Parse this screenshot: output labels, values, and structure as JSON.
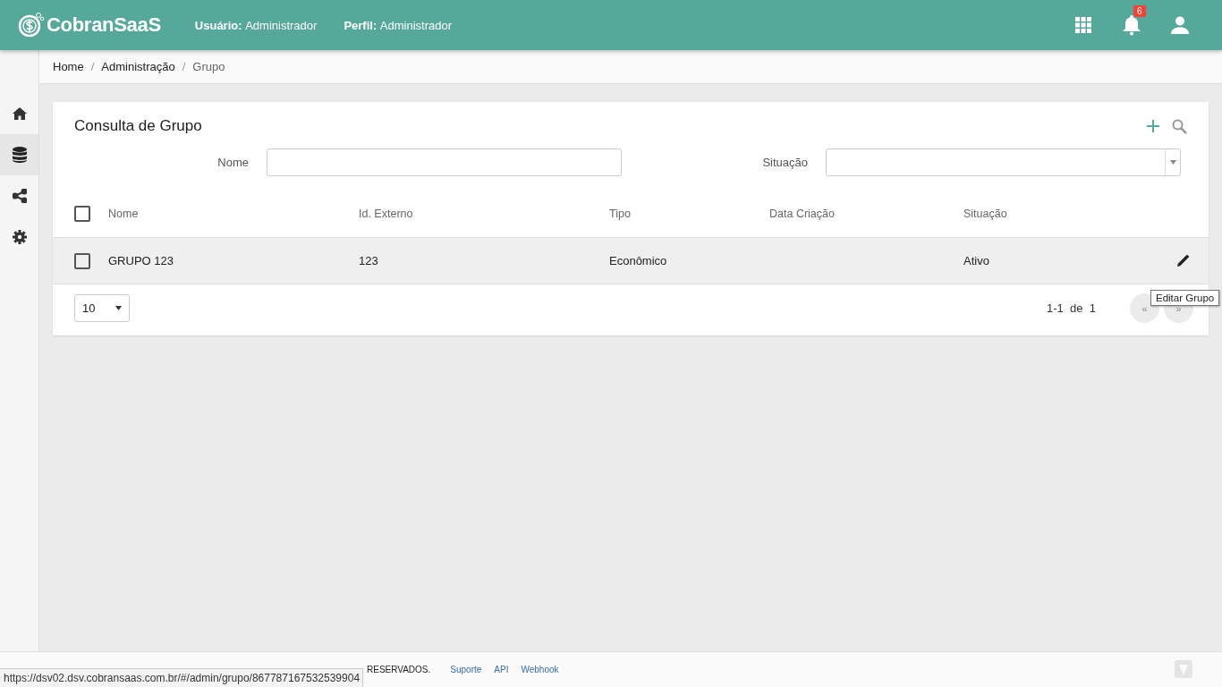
{
  "header": {
    "logo": "CobranSaaS",
    "user_label": "Usuário:",
    "user": "Administrador",
    "profile_label": "Perfil:",
    "profile": "Administrador",
    "notification_count": "6"
  },
  "sidebar": {
    "items": [
      {
        "kind": "home",
        "selected": false
      },
      {
        "kind": "database",
        "selected": true
      },
      {
        "kind": "share",
        "selected": false
      },
      {
        "kind": "settings",
        "selected": false
      }
    ]
  },
  "breadcrumb": {
    "items": [
      "Home",
      "Administração",
      "Grupo"
    ],
    "separators": [
      "/",
      "/"
    ]
  },
  "card": {
    "title": "Consulta de Grupo",
    "filters": [
      {
        "label": "Nome",
        "kind": "text"
      },
      {
        "label": "Situação",
        "kind": "select"
      }
    ],
    "table": {
      "select_all_checked": false,
      "columns": [
        "Nome",
        "Id. Externo",
        "Tipo",
        "Data Criação",
        "Situação"
      ],
      "rows": [
        {
          "checked": false,
          "nome": "GRUPO 123",
          "id_externo": "123",
          "tipo": "Econômico",
          "situacao": "Ativo"
        }
      ]
    },
    "page_size": "10",
    "range": "1-1",
    "of_label": "de",
    "total": "1",
    "prev": "«",
    "next": "»"
  },
  "tooltip": "Editar Grupo",
  "footer": {
    "text": "RESERVADOS.",
    "links": [
      "Suporte",
      "API",
      "Webhook"
    ]
  },
  "status_url": "https://dsv02.dsv.cobransaas.com.br/#/admin/grupo/867787167532539904"
}
